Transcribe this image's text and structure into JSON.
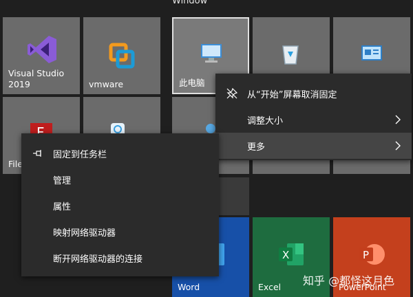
{
  "group_title": "Window",
  "tiles": {
    "vs": {
      "label": "Visual Studio 2019"
    },
    "vmware": {
      "label": "vmware"
    },
    "pc": {
      "label": "此电脑"
    },
    "file": {
      "label": "File"
    },
    "word": {
      "label": "Word"
    },
    "excel": {
      "label": "Excel"
    },
    "ppt": {
      "label": "PowerPoint"
    }
  },
  "right_menu": {
    "items": [
      {
        "label": "从“开始”屏幕取消固定",
        "icon": "unpin-icon"
      },
      {
        "label": "调整大小",
        "icon": "",
        "submenu": true
      },
      {
        "label": "更多",
        "icon": "",
        "submenu": true
      }
    ]
  },
  "left_menu": {
    "items": [
      {
        "label": "固定到任务栏",
        "icon": "pin-icon"
      },
      {
        "label": "管理"
      },
      {
        "label": "属性"
      },
      {
        "label": "映射网络驱动器"
      },
      {
        "label": "断开网络驱动器的连接"
      }
    ]
  },
  "watermark": "知乎 @都怪这月色",
  "colors": {
    "word": "#1750a8",
    "excel": "#1e6c3f",
    "powerpoint": "#c4401d",
    "tile": "#6b6b6b"
  }
}
